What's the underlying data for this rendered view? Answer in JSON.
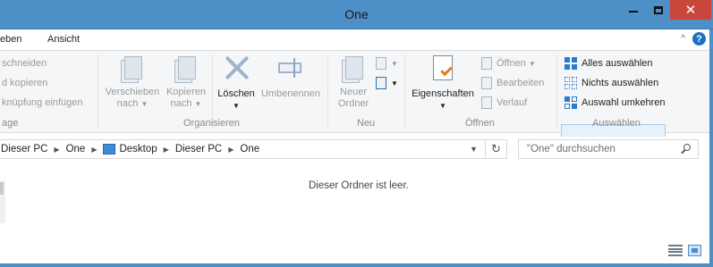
{
  "window": {
    "title": "One",
    "minimize": "",
    "maximize": "",
    "close": "✕"
  },
  "tabs": {
    "share": "eben",
    "view": "Ansicht",
    "collapse": "^",
    "help": "?"
  },
  "ribbon": {
    "clipboard": {
      "cut": "schneiden",
      "copy_path": "d kopieren",
      "paste_shortcut": "knüpfung einfügen",
      "group": "age"
    },
    "organize": {
      "move_to": "Verschieben",
      "move_to_sub": "nach",
      "copy_to": "Kopieren",
      "copy_to_sub": "nach",
      "delete": "Löschen",
      "rename": "Umbenennen",
      "group": "Organisieren"
    },
    "new": {
      "new_folder_1": "Neuer",
      "new_folder_2": "Ordner",
      "group": "Neu"
    },
    "open": {
      "properties": "Eigenschaften",
      "open": "Öffnen",
      "edit": "Bearbeiten",
      "history": "Verlauf",
      "group": "Öffnen"
    },
    "select": {
      "select_all": "Alles auswählen",
      "select_none": "Nichts auswählen",
      "invert": "Auswahl umkehren",
      "group": "Auswählen"
    }
  },
  "address": {
    "crumbs": [
      "Dieser PC",
      "One",
      "Desktop",
      "Dieser PC",
      "One"
    ],
    "search_placeholder": "\"One\" durchsuchen"
  },
  "content": {
    "empty_message": "Dieser Ordner ist leer."
  }
}
